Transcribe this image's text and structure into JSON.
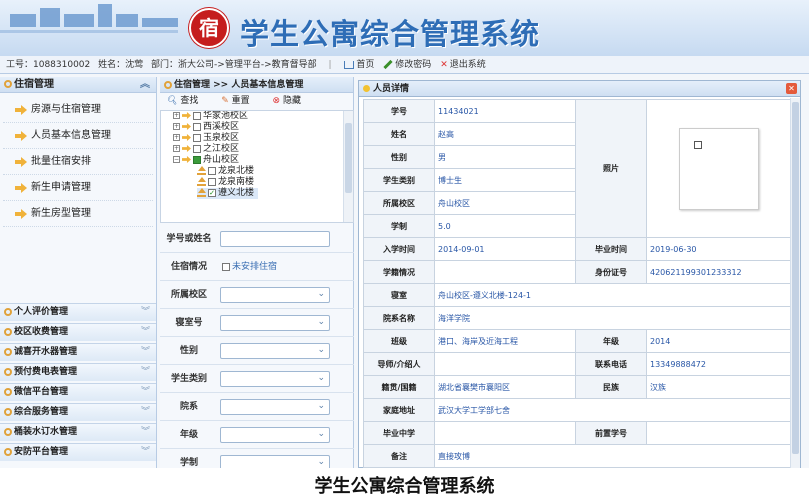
{
  "header": {
    "logo_char": "宿",
    "title": "学生公寓综合管理系统"
  },
  "userbar": {
    "id_text": "工号：1088310002",
    "name_text": "姓名：沈莺",
    "dept_text": "部门：浙大公司->管理平台->教育督导部",
    "home": "首页",
    "change_pwd": "修改密码",
    "logout": "退出系统"
  },
  "nav": {
    "header": "住宿管理",
    "items": [
      "房源与住宿管理",
      "人员基本信息管理",
      "批量住宿安排",
      "新生申请管理",
      "新生房型管理"
    ],
    "sections": [
      "个人评价管理",
      "校区收费管理",
      "诚喜开水器管理",
      "预付费电表管理",
      "微信平台管理",
      "综合服务管理",
      "桶装水订水管理",
      "安防平台管理"
    ]
  },
  "mid": {
    "breadcrumb": "住宿管理 >> 人员基本信息管理",
    "query": "查找",
    "reset": "重置",
    "hide": "隐藏",
    "tree": [
      "华家池校区",
      "西溪校区",
      "玉泉校区",
      "之江校区",
      "舟山校区",
      "龙泉北楼",
      "龙泉南楼",
      "遵义北楼"
    ],
    "fields": {
      "id_or_name": "学号或姓名",
      "stay": "住宿情况",
      "stay_option": "未安排住宿",
      "campus": "所属校区",
      "room": "寝室号",
      "gender": "性别",
      "student_type": "学生类别",
      "dept": "院系",
      "grade": "年级",
      "system": "学制"
    }
  },
  "detail": {
    "title": "人员详情",
    "labels": {
      "sid": "学号",
      "name": "姓名",
      "gender": "性别",
      "stype": "学生类别",
      "campus": "所属校区",
      "system": "学制",
      "enroll": "入学时间",
      "grad": "毕业时间",
      "status": "学籍情况",
      "idcard": "身份证号",
      "dorm": "寝室",
      "college": "院系名称",
      "class": "班级",
      "year": "年级",
      "tutor": "导师/介绍人",
      "phone": "联系电话",
      "native": "籍贯/国籍",
      "ethnic": "民族",
      "address": "家庭地址",
      "school": "毕业中学",
      "prev_id": "前置学号",
      "note": "备注",
      "photo": "照片"
    },
    "values": {
      "sid": "11434021",
      "name": "赵高",
      "gender": "男",
      "stype": "博士生",
      "campus": "舟山校区",
      "system": "5.0",
      "enroll": "2014-09-01",
      "grad": "2019-06-30",
      "status": "",
      "idcard": "420621199301233312",
      "dorm": "舟山校区-遵义北楼-124-1",
      "college": "海洋学院",
      "class": "港口、海岸及近海工程",
      "year": "2014",
      "tutor": "",
      "phone": "13349888472",
      "native": "湖北省襄樊市襄阳区",
      "ethnic": "汉族",
      "address": "武汉大学工学部七舍",
      "school": "",
      "prev_id": "",
      "note": "直接攻博"
    }
  },
  "caption": "学生公寓综合管理系统"
}
